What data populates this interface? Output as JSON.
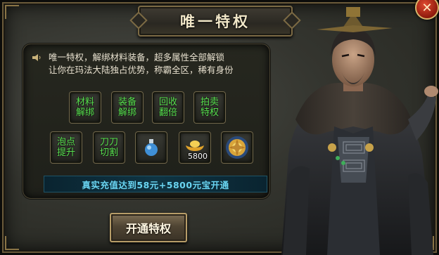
{
  "window": {
    "title": "唯一特权",
    "close_label": "✕"
  },
  "description": {
    "line1": "唯一特权，解绑材料装备，超多属性全部解锁",
    "line2": "让你在玛法大陆独占优势，称霸全区，稀有身份"
  },
  "privileges": [
    {
      "label": "材料\n解绑"
    },
    {
      "label": "装备\n解绑"
    },
    {
      "label": "回收\n翻倍"
    },
    {
      "label": "拍卖\n特权"
    },
    {
      "label": "泡点\n提升"
    },
    {
      "label": "刀刀\n切割"
    }
  ],
  "items": {
    "potion_icon": "blue-potion-icon",
    "ingot_icon": "gold-ingot-icon",
    "ingot_count": "5800",
    "medal_icon": "gold-medal-icon"
  },
  "promo_text": "真实充值达到58元+5800元宝开通",
  "activate_label": "开通特权",
  "colors": {
    "accent_green": "#58e04f",
    "promo_cyan": "#6ad5f2",
    "gold_border": "#b79d68",
    "close_red": "#c0301c"
  }
}
